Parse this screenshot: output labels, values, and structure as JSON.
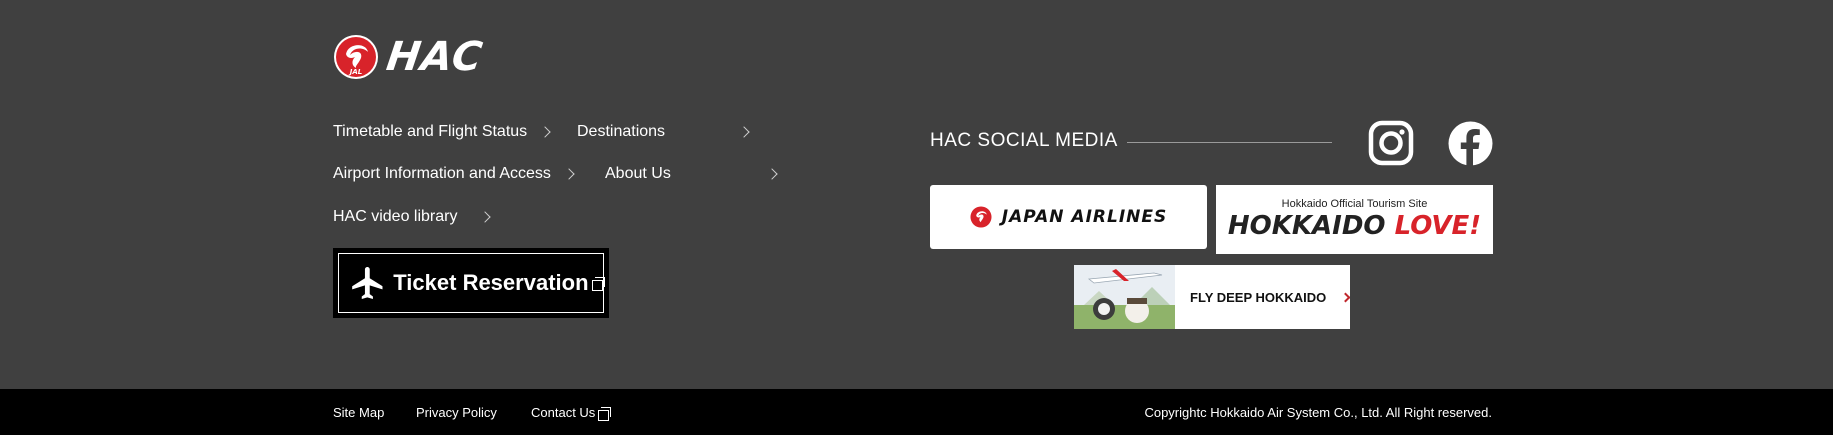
{
  "brand": {
    "logo_text": "HAC",
    "jal_mark_text": "JAL"
  },
  "nav": {
    "items": [
      {
        "label": "Timetable and Flight Status"
      },
      {
        "label": "Destinations"
      },
      {
        "label": "Airport Information and Access"
      },
      {
        "label": "About Us"
      },
      {
        "label": "HAC video library"
      }
    ]
  },
  "ticket": {
    "label": "Ticket Reservation"
  },
  "social": {
    "title": "HAC SOCIAL MEDIA",
    "icons": [
      "instagram-icon",
      "facebook-icon"
    ]
  },
  "banners": {
    "jal": {
      "label": "JAPAN AIRLINES"
    },
    "hokkaido": {
      "subtitle": "Hokkaido Official Tourism Site",
      "title_part1": "HOKKAIDO ",
      "title_part2": "LOVE!"
    },
    "fly": {
      "label": "FLY DEEP HOKKAIDO"
    }
  },
  "footer": {
    "links": [
      {
        "label": "Site Map"
      },
      {
        "label": "Privacy Policy"
      },
      {
        "label": "Contact Us"
      }
    ],
    "copyright": "Copyrightc Hokkaido Air System Co., Ltd. All Right reserved."
  },
  "colors": {
    "background": "#404040",
    "footer": "#000000",
    "jal_red": "#d8232a",
    "text": "#ffffff"
  }
}
